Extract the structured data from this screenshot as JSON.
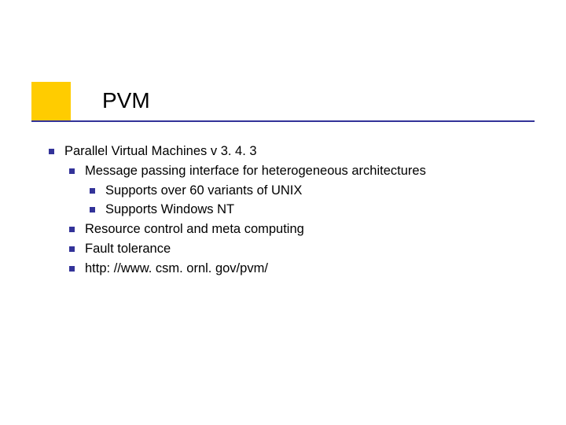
{
  "title": "PVM",
  "bullets": {
    "l1": "Parallel Virtual Machines v 3. 4. 3",
    "l2a": "Message passing interface for heterogeneous architectures",
    "l3a": "Supports over 60 variants of UNIX",
    "l3b": "Supports Windows NT",
    "l2b": "Resource control and meta computing",
    "l2c": "Fault tolerance",
    "l2d": "http: //www. csm. ornl. gov/pvm/"
  }
}
